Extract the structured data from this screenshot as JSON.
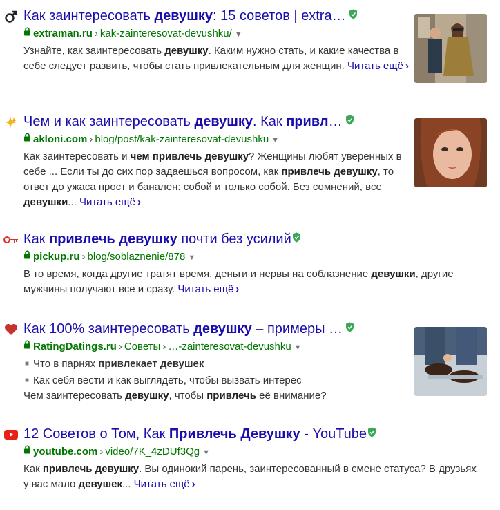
{
  "results": [
    {
      "icon": "male-symbol-icon",
      "title_pre": "Как заинтересовать ",
      "title_bold": "девушку",
      "title_post": ": 15 советов | extra…",
      "host": "extraman.ru",
      "path": "kak-zainteresovat-devushku/",
      "snippet": [
        {
          "t": "Узнайте, как заинтересовать ",
          "b": false
        },
        {
          "t": "девушку",
          "b": true
        },
        {
          "t": ". Каким нужно стать, и какие качества в себе следует развить, чтобы стать привлекательным для женщин. ",
          "b": false
        }
      ],
      "more": "Читать ещё",
      "thumb": "couple-walking-image"
    },
    {
      "icon": "sparkle-icon",
      "title_pre": "Чем и как заинтересовать ",
      "title_bold": "девушку",
      "title_mid": ". Как ",
      "title_bold2": "привл",
      "title_post": "…",
      "host": "akloni.com",
      "path": "blog/post/kak-zainteresovat-devushku",
      "snippet": [
        {
          "t": "Как заинтересовать и ",
          "b": false
        },
        {
          "t": "чем привлечь девушку",
          "b": true
        },
        {
          "t": "? Женщины любят уверенных в себе ... Если ты до сих пор задаешься вопросом, как ",
          "b": false
        },
        {
          "t": "привлечь девушку",
          "b": true
        },
        {
          "t": ", то ответ до ужаса прост и банален: собой и только собой. Без сомнений, все ",
          "b": false
        },
        {
          "t": "девушки",
          "b": true
        },
        {
          "t": "... ",
          "b": false
        }
      ],
      "more": "Читать ещё",
      "thumb": "woman-portrait-image"
    },
    {
      "icon": "key-icon",
      "title_pre": "Как ",
      "title_bold": "привлечь девушку",
      "title_post": " почти без усилий",
      "host": "pickup.ru",
      "path": "blog/soblaznenie/878",
      "snippet": [
        {
          "t": "В то время, когда другие тратят время, деньги и нервы на соблазнение ",
          "b": false
        },
        {
          "t": "девушки",
          "b": true
        },
        {
          "t": ", другие мужчины получают все и сразу. ",
          "b": false
        }
      ],
      "more": "Читать ещё"
    },
    {
      "icon": "heart-icon",
      "title_pre": "Как 100% заинтересовать ",
      "title_bold": "девушку",
      "title_post": " – примеры …",
      "host": "RatingDatings.ru",
      "path": "Советы",
      "path2": "…-zainteresovat-devushku",
      "bullets": [
        [
          {
            "t": "Что в парнях ",
            "b": false
          },
          {
            "t": "привлекает девушек",
            "b": true
          }
        ],
        [
          {
            "t": "Как себя вести и как выглядеть, чтобы вызвать интерес",
            "b": false
          }
        ]
      ],
      "snippet": [
        {
          "t": "Чем заинтересовать ",
          "b": false
        },
        {
          "t": "девушку",
          "b": true
        },
        {
          "t": ", чтобы ",
          "b": false
        },
        {
          "t": "привлечь",
          "b": true
        },
        {
          "t": " её внимание?",
          "b": false
        }
      ],
      "thumb": "shoes-image"
    },
    {
      "icon": "youtube-icon",
      "title_pre": "12 Советов о Том, Как ",
      "title_bold": "Привлечь Девушку",
      "title_post": " - YouTube",
      "host": "youtube.com",
      "path": "video/7K_4zDUf3Qg",
      "snippet": [
        {
          "t": "Как ",
          "b": false
        },
        {
          "t": "привлечь девушку",
          "b": true
        },
        {
          "t": ". Вы одинокий парень, заинтересованный в смене статуса? В друзьях у вас мало ",
          "b": false
        },
        {
          "t": "девушек",
          "b": true
        },
        {
          "t": "... ",
          "b": false
        }
      ],
      "more": "Читать ещё"
    }
  ],
  "colors": {
    "link": "#1a0dab",
    "url": "#007700",
    "shield": "#3aa757"
  }
}
